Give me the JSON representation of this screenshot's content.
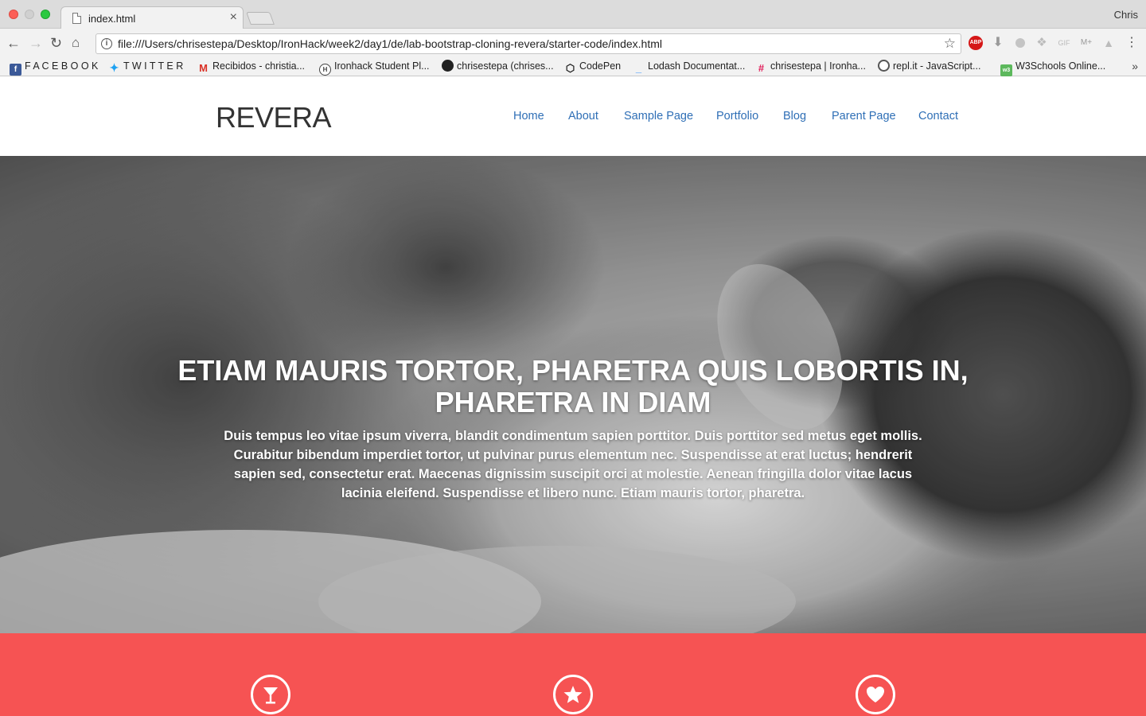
{
  "browser": {
    "tab_title": "index.html",
    "profile_name": "Chris",
    "url": "file:///Users/chrisestepa/Desktop/IronHack/week2/day1/de/lab-bootstrap-cloning-revera/starter-code/index.html",
    "bookmarks": [
      {
        "label": "F A C E B O O K",
        "icon": "facebook-icon"
      },
      {
        "label": "T W I T T E R",
        "icon": "twitter-icon"
      },
      {
        "label": "Recibidos - christia...",
        "icon": "gmail-icon"
      },
      {
        "label": "Ironhack Student Pl...",
        "icon": "ironhack-icon"
      },
      {
        "label": "chrisestepa (chrises...",
        "icon": "github-icon"
      },
      {
        "label": "CodePen",
        "icon": "codepen-icon"
      },
      {
        "label": "Lodash Documentat...",
        "icon": "lodash-icon"
      },
      {
        "label": "chrisestepa | Ironha...",
        "icon": "slack-icon"
      },
      {
        "label": "repl.it - JavaScript...",
        "icon": "replit-icon"
      },
      {
        "label": "W3Schools Online...",
        "icon": "w3schools-icon"
      }
    ],
    "overflow_chevron": "»"
  },
  "site": {
    "logo": "REVERA",
    "nav": [
      "Home",
      "About",
      "Sample Page",
      "Portfolio",
      "Blog",
      "Parent Page",
      "Contact"
    ],
    "nav_color": "#2f6fb6"
  },
  "hero": {
    "title": "ETIAM MAURIS TORTOR, PHARETRA QUIS LOBORTIS IN, PHARETRA IN DIAM",
    "text": "Duis tempus leo vitae ipsum viverra, blandit condimentum sapien porttitor. Duis porttitor sed metus eget mollis. Curabitur bibendum imperdiet tortor, ut pulvinar purus elementum nec. Suspendisse at erat luctus; hendrerit sapien sed, consectetur erat. Maecenas dignissim suscipit orci at molestie. Aenean fringilla dolor vitae lacus lacinia eleifend. Suspendisse et libero nunc. Etiam mauris tortor, pharetra."
  },
  "features": {
    "background": "#f65353",
    "icons": [
      "cocktail-icon",
      "star-icon",
      "heart-icon"
    ]
  }
}
